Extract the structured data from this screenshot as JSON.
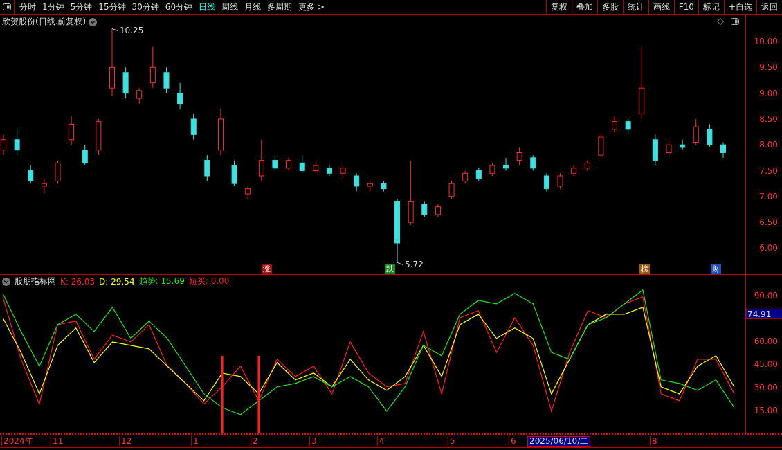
{
  "toolbar": {
    "periods": [
      {
        "label": "分时",
        "selected": false
      },
      {
        "label": "1分钟",
        "selected": false
      },
      {
        "label": "5分钟",
        "selected": false
      },
      {
        "label": "15分钟",
        "selected": false
      },
      {
        "label": "30分钟",
        "selected": false
      },
      {
        "label": "60分钟",
        "selected": false
      },
      {
        "label": "日线",
        "selected": true
      },
      {
        "label": "周线",
        "selected": false
      },
      {
        "label": "月线",
        "selected": false
      },
      {
        "label": "多周期",
        "selected": false
      },
      {
        "label": "更多 >",
        "selected": false
      }
    ],
    "buttons": [
      "复权",
      "叠加",
      "多股",
      "统计",
      "画线",
      "F10",
      "标记",
      "+自选",
      "返回"
    ]
  },
  "price_panel": {
    "title": "欣贺股份(日线.前复权)",
    "markers": [
      {
        "label": "涨",
        "color": "#a01010"
      },
      {
        "label": "跌",
        "color": "#1a8a1a"
      },
      {
        "label": "榜",
        "color": "#a05a10"
      },
      {
        "label": "财",
        "color": "#2050c0"
      }
    ],
    "chart_data": {
      "type": "candlestick",
      "ohlc": [
        [
          7.9,
          8.2,
          7.8,
          8.1
        ],
        [
          8.1,
          8.3,
          7.8,
          7.9
        ],
        [
          7.5,
          7.6,
          7.25,
          7.3
        ],
        [
          7.2,
          7.35,
          7.05,
          7.25
        ],
        [
          7.3,
          7.7,
          7.25,
          7.65
        ],
        [
          8.1,
          8.55,
          8.0,
          8.4
        ],
        [
          7.9,
          8.0,
          7.6,
          7.65
        ],
        [
          7.9,
          8.5,
          7.8,
          8.45
        ],
        [
          9.1,
          10.25,
          8.95,
          9.5
        ],
        [
          9.4,
          9.5,
          8.9,
          9.0
        ],
        [
          8.9,
          9.1,
          8.8,
          9.05
        ],
        [
          9.2,
          9.9,
          9.1,
          9.5
        ],
        [
          9.4,
          9.5,
          9.0,
          9.1
        ],
        [
          9.0,
          9.2,
          8.7,
          8.8
        ],
        [
          8.5,
          8.6,
          8.1,
          8.2
        ],
        [
          7.7,
          7.8,
          7.3,
          7.4
        ],
        [
          7.9,
          8.7,
          7.8,
          8.5
        ],
        [
          7.6,
          7.7,
          7.2,
          7.25
        ],
        [
          7.05,
          7.2,
          6.95,
          7.15
        ],
        [
          7.4,
          8.1,
          7.3,
          7.7
        ],
        [
          7.7,
          7.8,
          7.5,
          7.55
        ],
        [
          7.55,
          7.75,
          7.5,
          7.7
        ],
        [
          7.65,
          7.8,
          7.45,
          7.5
        ],
        [
          7.5,
          7.7,
          7.45,
          7.6
        ],
        [
          7.55,
          7.6,
          7.4,
          7.45
        ],
        [
          7.45,
          7.6,
          7.35,
          7.55
        ],
        [
          7.4,
          7.45,
          7.1,
          7.2
        ],
        [
          7.2,
          7.3,
          7.1,
          7.25
        ],
        [
          7.25,
          7.3,
          7.1,
          7.15
        ],
        [
          6.9,
          6.95,
          5.72,
          6.1
        ],
        [
          6.5,
          7.7,
          6.45,
          6.9
        ],
        [
          6.85,
          6.9,
          6.6,
          6.65
        ],
        [
          6.65,
          6.85,
          6.6,
          6.8
        ],
        [
          7.0,
          7.3,
          6.95,
          7.25
        ],
        [
          7.3,
          7.5,
          7.25,
          7.45
        ],
        [
          7.5,
          7.55,
          7.3,
          7.35
        ],
        [
          7.45,
          7.65,
          7.4,
          7.6
        ],
        [
          7.6,
          7.75,
          7.5,
          7.55
        ],
        [
          7.7,
          7.95,
          7.6,
          7.85
        ],
        [
          7.75,
          7.8,
          7.5,
          7.55
        ],
        [
          7.4,
          7.45,
          7.1,
          7.15
        ],
        [
          7.2,
          7.45,
          7.15,
          7.4
        ],
        [
          7.45,
          7.6,
          7.4,
          7.55
        ],
        [
          7.55,
          7.7,
          7.5,
          7.65
        ],
        [
          7.8,
          8.2,
          7.75,
          8.15
        ],
        [
          8.3,
          8.55,
          8.25,
          8.45
        ],
        [
          8.45,
          8.5,
          8.2,
          8.3
        ],
        [
          8.6,
          9.9,
          8.5,
          9.1
        ],
        [
          8.1,
          8.2,
          7.6,
          7.7
        ],
        [
          7.85,
          8.1,
          7.8,
          8.0
        ],
        [
          8.0,
          8.1,
          7.9,
          7.95
        ],
        [
          8.05,
          8.5,
          8.0,
          8.35
        ],
        [
          8.3,
          8.4,
          7.95,
          8.0
        ],
        [
          8.0,
          8.05,
          7.75,
          7.85
        ]
      ],
      "ylim": [
        5.483,
        10.523
      ],
      "yticks": [
        {
          "value": 10,
          "label": "10.00"
        },
        {
          "value": 9.5,
          "label": "9.50"
        },
        {
          "value": 9,
          "label": "9.00"
        },
        {
          "value": 8.5,
          "label": "8.50"
        },
        {
          "value": 8,
          "label": "8.00"
        },
        {
          "value": 7.5,
          "label": "7.50"
        },
        {
          "value": 7,
          "label": "7.00"
        },
        {
          "value": 6.5,
          "label": "6.50"
        },
        {
          "value": 6,
          "label": "6.00"
        }
      ],
      "annotations": [
        "10.25",
        "5.72"
      ]
    }
  },
  "indicator_panel": {
    "name": "股朋指标网",
    "current_value": "74.91",
    "readings": [
      ": 26.03",
      ": 29.54",
      ": 15.69",
      ": 0.00"
    ],
    "chart_data": {
      "type": "line",
      "ylim": [
        0,
        103.5
      ],
      "yticks": [
        {
          "value": 15,
          "label": "15.00"
        },
        {
          "value": 30,
          "label": "30.00"
        },
        {
          "value": 45,
          "label": "45.00"
        },
        {
          "value": 60,
          "label": "60.00"
        },
        {
          "value": 90,
          "label": "90.00"
        }
      ],
      "series": [
        {
          "name": "K",
          "type": "line",
          "color": "#ff2020",
          "values": [
            89.1,
            48.4,
            19.1,
            71.0,
            73.3,
            48.4,
            64.2,
            59.7,
            71.0,
            43.9,
            32.6,
            19.1,
            30.4,
            43.9,
            21.3,
            48.4,
            37.1,
            43.9,
            25.8,
            59.7,
            39.4,
            30.4,
            32.6,
            66.5,
            25.8,
            75.5,
            80.1,
            52.9,
            75.5,
            57.5,
            14.5,
            52.9,
            80.1,
            75.5,
            84.6,
            89.1,
            25.8,
            21.3,
            48.4,
            48.4,
            25.8
          ]
        },
        {
          "name": "D",
          "type": "line",
          "color": "#ffff00",
          "values": [
            75.5,
            52.9,
            25.8,
            57.5,
            68.8,
            46.2,
            59.7,
            57.5,
            55.2,
            43.9,
            32.6,
            21.3,
            39.4,
            37.1,
            25.8,
            46.2,
            34.9,
            39.4,
            30.4,
            48.4,
            34.9,
            28.1,
            37.1,
            57.5,
            37.1,
            71.0,
            77.8,
            62.0,
            68.8,
            62.0,
            25.8,
            48.4,
            71.0,
            77.8,
            77.8,
            82.3,
            30.4,
            25.8,
            43.9,
            50.7,
            30.4
          ]
        },
        {
          "name": "趋势",
          "type": "line",
          "color": "#20e020",
          "values": [
            91.4,
            66.5,
            43.9,
            71.0,
            77.8,
            66.5,
            82.3,
            62.0,
            73.3,
            62.0,
            43.9,
            25.8,
            16.8,
            12.3,
            21.3,
            30.4,
            32.6,
            37.1,
            30.4,
            37.1,
            30.4,
            14.5,
            30.4,
            57.5,
            50.7,
            77.8,
            86.8,
            84.6,
            91.4,
            84.6,
            52.9,
            48.4,
            71.0,
            75.5,
            84.6,
            93.6,
            34.9,
            32.6,
            28.1,
            34.9,
            16.8
          ]
        },
        {
          "name": "短买",
          "type": "bar",
          "color": "#ff2020",
          "values": [
            null,
            null,
            null,
            null,
            null,
            null,
            null,
            null,
            null,
            null,
            null,
            null,
            50.7,
            null,
            50.7,
            null,
            null,
            null,
            null,
            null,
            null,
            null,
            null,
            null,
            null,
            null,
            null,
            null,
            null,
            null,
            null,
            null,
            null,
            null,
            null,
            null,
            null,
            null,
            null,
            null,
            null
          ]
        }
      ]
    }
  },
  "timeline": {
    "labels": [
      "2024年",
      "11",
      "12",
      "1",
      "2",
      "3",
      "4",
      "5",
      "6",
      "8"
    ],
    "cursor_label": "2025/06/10/二"
  }
}
